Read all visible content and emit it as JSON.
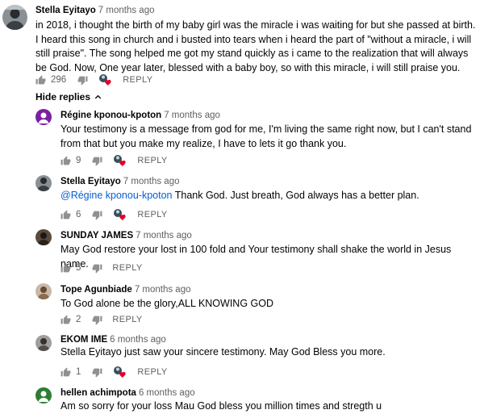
{
  "main_comment": {
    "author": "Stella Eyitayo",
    "time": "7 months ago",
    "text": "in 2018, i thought the birth of my baby girl was the miracle i was waiting for but she passed at birth. I heard this song in church and i busted into tears when i heard the part of \"without a miracle, i will still praise\". The song helped me got my stand quickly as i came to the realization that will always be God. Now, One year later, blessed with a baby boy, so with this miracle, i will still praise you.",
    "likes": "296",
    "reply_label": "REPLY"
  },
  "hide_replies_label": "Hide replies",
  "replies": [
    {
      "author": "Régine kponou-kpoton",
      "time": "7 months ago",
      "text": "Your testimony is a message from god for me, I'm living the same right now, but I can't stand from that but you make my realize, I have to lets it go thank you.",
      "likes": "9",
      "reply_label": "REPLY",
      "avatar": {
        "type": "letter",
        "letter": "R",
        "color": "#7b1fa2"
      }
    },
    {
      "author": "Stella Eyitayo",
      "time": "7 months ago",
      "mention": "@Régine kponou-kpoton",
      "text": " Thank God. Just breath, God always has a better plan.",
      "likes": "6",
      "reply_label": "REPLY",
      "avatar": {
        "type": "photo"
      }
    },
    {
      "author": "SUNDAY JAMES",
      "time": "7 months ago",
      "text": "May God restore your lost in 100 fold and Your testimony shall shake the world in Jesus name.",
      "likes": "5",
      "reply_label": "REPLY",
      "avatar": {
        "type": "photo"
      }
    },
    {
      "author": "Tope Agunbiade",
      "time": "7 months ago",
      "text": "To God alone be the glory,ALL KNOWING GOD",
      "likes": "2",
      "reply_label": "REPLY",
      "avatar": {
        "type": "photo"
      }
    },
    {
      "author": "EKOM IME",
      "time": "6 months ago",
      "text": "Stella Eyitayo just saw your sincere testimony. May God Bless you more.",
      "likes": "1",
      "reply_label": "REPLY",
      "avatar": {
        "type": "photo"
      }
    },
    {
      "author": "hellen achimpota",
      "time": "6 months ago",
      "text": "Am so sorry for your loss Mau God bless you million times and stregth u",
      "avatar": {
        "type": "letter",
        "letter": "h",
        "color": "#2e7d32"
      }
    }
  ],
  "icons": {
    "like": "thumb-up-icon",
    "dislike": "thumb-down-icon",
    "creator_heart": "creator-heart-icon",
    "chevron": "chevron-up-icon"
  },
  "colors": {
    "heart": "#e1002d",
    "mention": "#065fd4",
    "muted": "#606060"
  }
}
